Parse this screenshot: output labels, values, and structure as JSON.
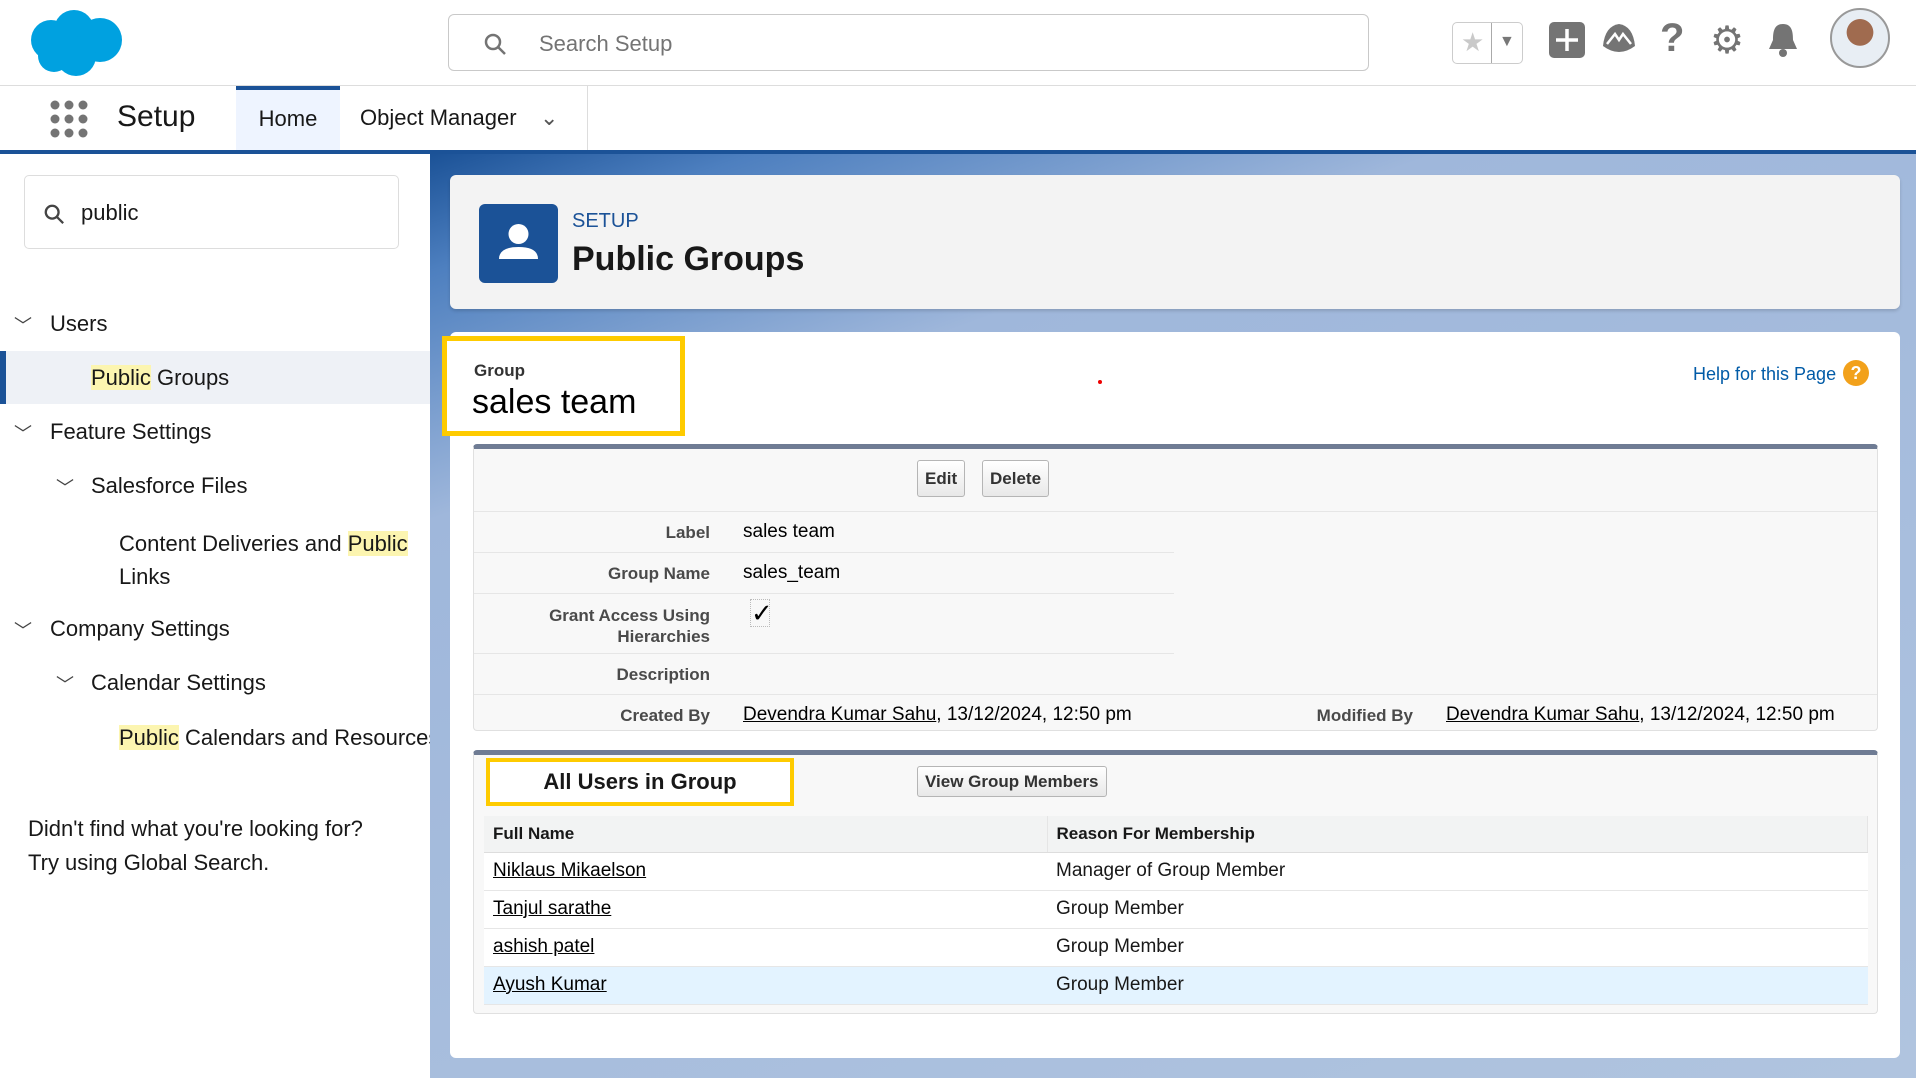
{
  "header": {
    "search_placeholder": "Search Setup"
  },
  "nav": {
    "app_title": "Setup",
    "tabs": [
      {
        "label": "Home"
      },
      {
        "label": "Object Manager"
      }
    ]
  },
  "sidebar": {
    "quick_find": "public",
    "items": [
      {
        "label": "Users"
      },
      {
        "label_hl": "Public",
        "label_rest": " Groups"
      },
      {
        "label": "Feature Settings"
      },
      {
        "label": "Salesforce Files"
      },
      {
        "label_pre": "Content Deliveries and ",
        "label_hl": "Public",
        "label_rest": "Links"
      },
      {
        "label": "Company Settings"
      },
      {
        "label": "Calendar Settings"
      },
      {
        "label_hl": "Public",
        "label_rest": " Calendars and Resources"
      }
    ],
    "not_found_1": "Didn't find what you're looking for?",
    "not_found_2": "Try using Global Search."
  },
  "page": {
    "kicker": "SETUP",
    "title": "Public Groups"
  },
  "record": {
    "type_label": "Group",
    "name": "sales team",
    "help_link": "Help for this Page",
    "help_icon": "?",
    "buttons": {
      "edit": "Edit",
      "delete": "Delete"
    },
    "fields": {
      "label": {
        "k": "Label",
        "v": "sales team"
      },
      "group_name": {
        "k": "Group Name",
        "v": "sales_team"
      },
      "grant": {
        "k1": "Grant Access Using",
        "k2": "Hierarchies",
        "checked": true
      },
      "description": {
        "k": "Description",
        "v": ""
      },
      "created_by": {
        "k": "Created By",
        "user": "Devendra Kumar Sahu",
        "date": ", 13/12/2024, 12:50 pm"
      },
      "modified_by": {
        "k": "Modified By",
        "user": "Devendra Kumar Sahu",
        "date": ", 13/12/2024, 12:50 pm"
      }
    }
  },
  "users": {
    "title": "All Users in Group",
    "view_button": "View Group Members",
    "columns": [
      "Full Name",
      "Reason For Membership"
    ],
    "rows": [
      {
        "name": "Niklaus Mikaelson",
        "reason": "Manager of Group Member"
      },
      {
        "name": "Tanjul sarathe",
        "reason": "Group Member"
      },
      {
        "name": "ashish patel",
        "reason": "Group Member"
      },
      {
        "name": "Ayush Kumar",
        "reason": "Group Member"
      }
    ]
  }
}
